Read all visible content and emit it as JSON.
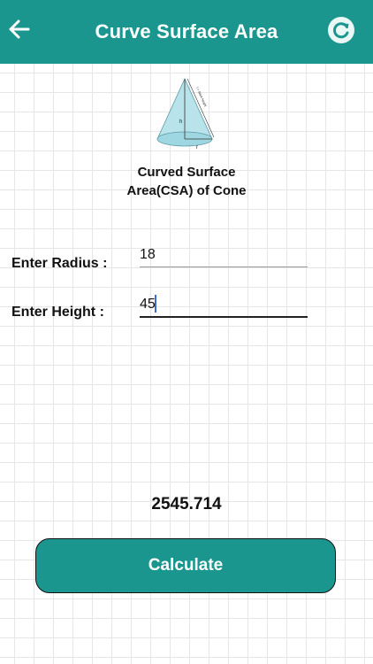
{
  "app_bar": {
    "title": "Curve Surface Area",
    "back_icon": "arrow-left-icon",
    "refresh_icon": "refresh-icon",
    "color": "#1b968f"
  },
  "figure": {
    "caption_line1": "Curved Surface",
    "caption_line2": "Area(CSA) of Cone",
    "labels": {
      "height": "h",
      "radius": "r",
      "slant": "l = Slant height"
    }
  },
  "form": {
    "radius_label": "Enter Radius :",
    "radius_value": "18",
    "height_label": "Enter Height :",
    "height_value": "45"
  },
  "result": "2545.714",
  "calculate_label": "Calculate"
}
